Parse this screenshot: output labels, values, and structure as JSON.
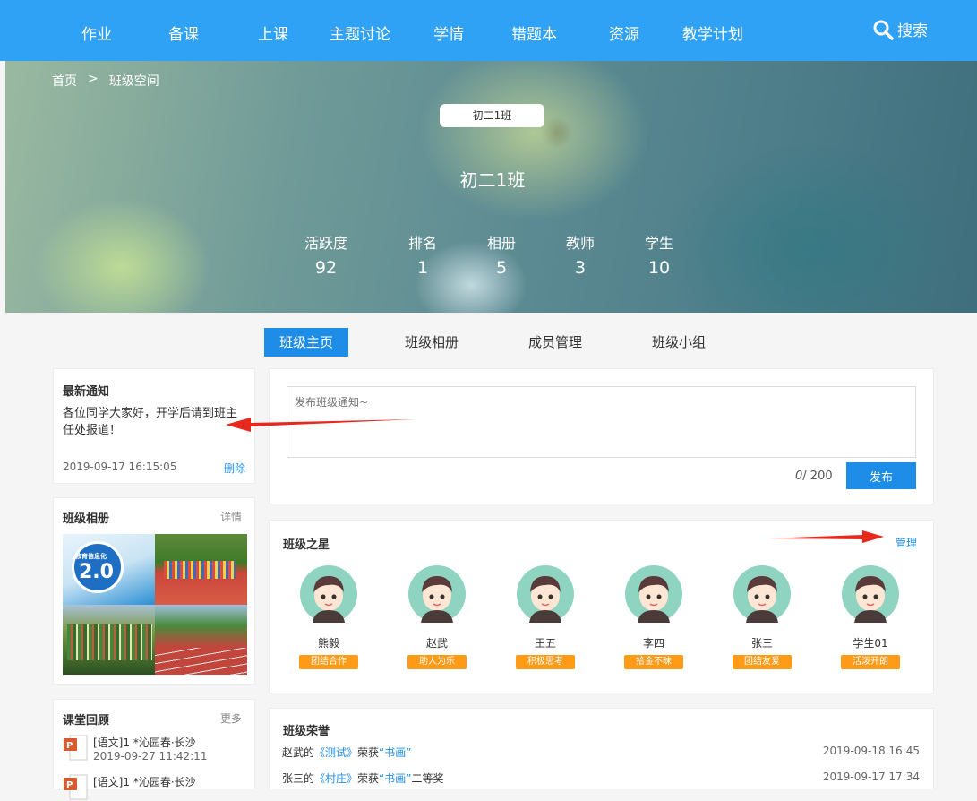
{
  "nav": {
    "items": [
      "作业",
      "备课",
      "上课",
      "主题讨论",
      "学情",
      "错题本",
      "资源",
      "教学计划"
    ],
    "search_label": "搜索"
  },
  "breadcrumb": {
    "home": "首页",
    "sep": ">",
    "current": "班级空间"
  },
  "banner": {
    "class_pill": "初二1班",
    "class_title": "初二1班",
    "stats": [
      {
        "label": "活跃度",
        "value": "92"
      },
      {
        "label": "排名",
        "value": "1"
      },
      {
        "label": "相册",
        "value": "5"
      },
      {
        "label": "教师",
        "value": "3"
      },
      {
        "label": "学生",
        "value": "10"
      }
    ]
  },
  "tabs": [
    "班级主页",
    "班级相册",
    "成员管理",
    "班级小组"
  ],
  "notice": {
    "title": "最新通知",
    "text": "各位同学大家好，开学后请到班主任处报道！",
    "time": "2019-09-17 16:15:05",
    "delete_label": "删除"
  },
  "album": {
    "title": "班级相册",
    "detail_label": "详情",
    "photo1_text": "教育信息化",
    "photo1_big": "2.0"
  },
  "review": {
    "title": "课堂回顾",
    "more_label": "更多",
    "items": [
      {
        "title": "[语文]1 *沁园春·长沙",
        "time": "2019-09-27 11:42:11"
      },
      {
        "title": "[语文]1 *沁园春·长沙",
        "time": ""
      }
    ]
  },
  "post": {
    "placeholder": "发布班级通知~",
    "count": "0",
    "max": "/ 200",
    "publish_label": "发布"
  },
  "stars": {
    "title": "班级之星",
    "manage_label": "管理",
    "items": [
      {
        "name": "熊毅",
        "tag": "团结合作"
      },
      {
        "name": "赵武",
        "tag": "助人为乐"
      },
      {
        "name": "王五",
        "tag": "积极思考"
      },
      {
        "name": "李四",
        "tag": "拾金不昧"
      },
      {
        "name": "张三",
        "tag": "团结友爱"
      },
      {
        "name": "学生01",
        "tag": "活泼开朗"
      }
    ]
  },
  "honors": {
    "title": "班级荣誉",
    "items": [
      {
        "who": "赵武的",
        "work": "《测试》",
        "mid": "荣获",
        "award": "“书画”",
        "suffix": "",
        "time": "2019-09-18 16:45"
      },
      {
        "who": "张三的",
        "work": "《村庄》",
        "mid": "荣获",
        "award": "“书画”",
        "suffix": "二等奖",
        "time": "2019-09-17 17:34"
      }
    ]
  },
  "colors": {
    "nav": "#2fa2f6",
    "accent": "#1e8de8",
    "badge": "#ff9b16",
    "arrow": "#e8281c"
  }
}
